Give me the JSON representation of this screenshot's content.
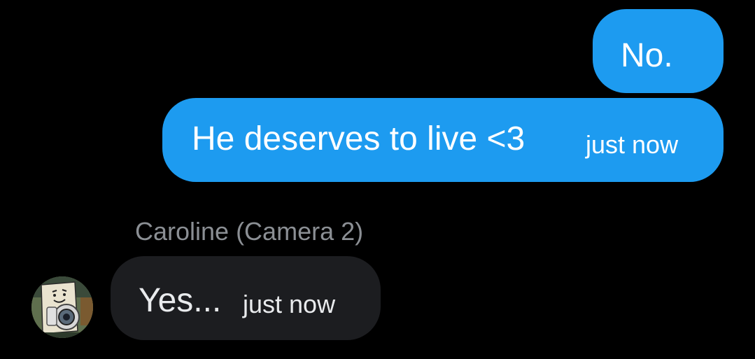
{
  "messages": [
    {
      "text": "No."
    },
    {
      "text": "He deserves to live <3",
      "time": "just now"
    },
    {
      "sender": "Caroline (Camera 2)",
      "text": "Yes...",
      "time": "just now"
    }
  ],
  "colors": {
    "background": "#000000",
    "outgoing_bubble": "#1d9bf0",
    "incoming_bubble": "#1c1d20",
    "sender_name": "#8b8f94"
  }
}
